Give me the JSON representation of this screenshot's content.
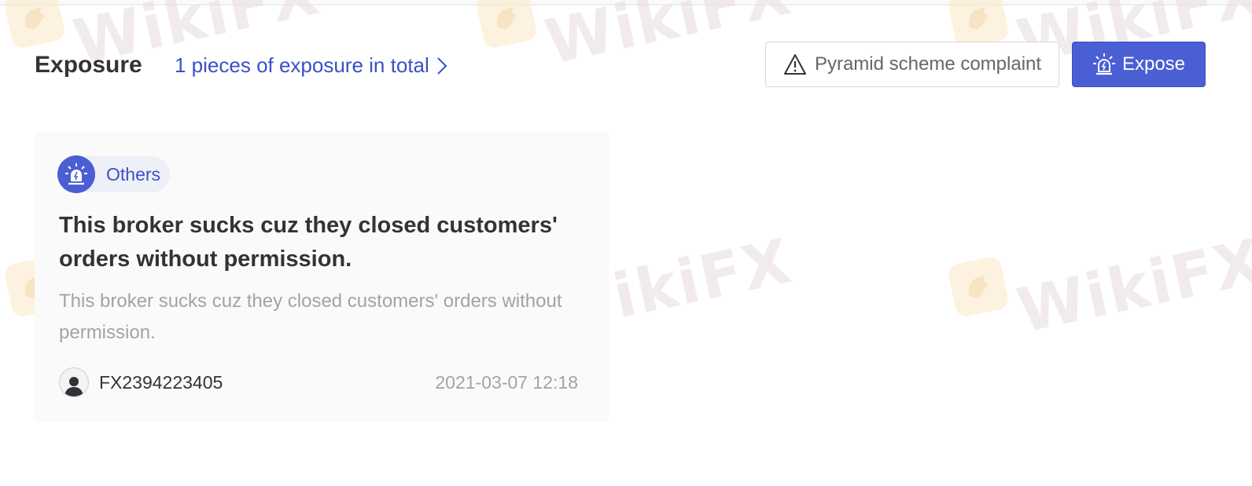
{
  "watermark": {
    "text": "WikiFX"
  },
  "header": {
    "title": "Exposure",
    "total_link": "1 pieces of exposure in total",
    "complaint_button": "Pyramid scheme complaint",
    "expose_button": "Expose"
  },
  "exposure_card": {
    "category": "Others",
    "title": "This broker sucks cuz they closed customers' orders without permission.",
    "description": "This broker sucks cuz they closed customers' orders without permission.",
    "author": "FX2394223405",
    "timestamp": "2021-03-07 12:18"
  },
  "icons": {
    "total_link": "chevron-right-icon",
    "complaint": "warning-triangle-icon",
    "expose": "alarm-siren-icon",
    "category": "alarm-siren-icon",
    "author": "user-avatar-icon"
  },
  "colors": {
    "accent": "#4a5fd4",
    "link": "#3a51c4",
    "text": "#333333",
    "muted": "#a3a3a3",
    "card_bg": "#fafafa"
  }
}
